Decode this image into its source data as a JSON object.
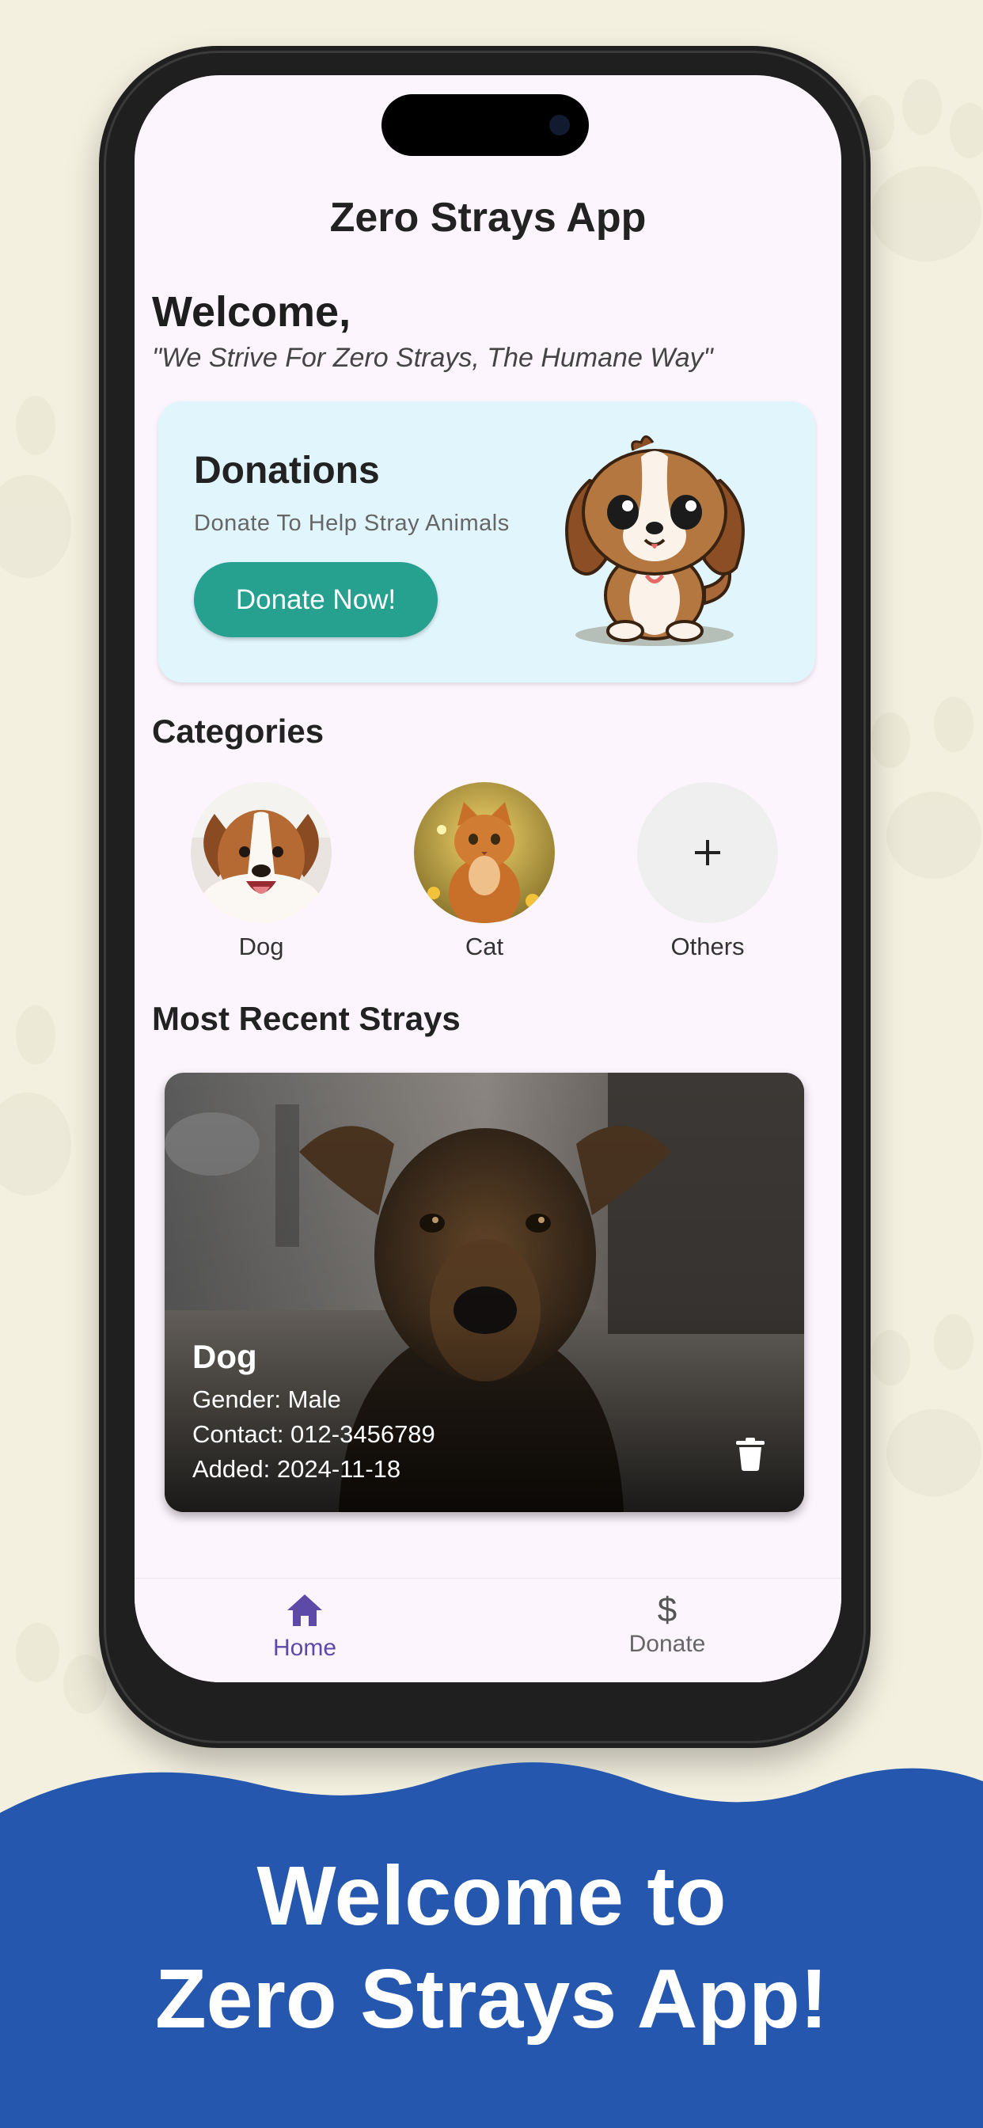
{
  "app": {
    "title": "Zero Strays App",
    "welcome": "Welcome,",
    "quote": "\"We Strive For Zero Strays, The Humane Way\""
  },
  "donation": {
    "title": "Donations",
    "subtitle": "Donate To Help Stray Animals",
    "button_label": "Donate Now!"
  },
  "categories": {
    "title": "Categories",
    "items": [
      {
        "label": "Dog"
      },
      {
        "label": "Cat"
      },
      {
        "label": "Others",
        "icon": "plus-icon"
      }
    ]
  },
  "recent": {
    "title": "Most Recent Strays",
    "card": {
      "name": "Dog",
      "gender": "Gender: Male",
      "contact": "Contact: 012-3456789",
      "added": "Added: 2024-11-18",
      "action_icon": "trash-icon"
    }
  },
  "nav": {
    "items": [
      {
        "label": "Home",
        "icon": "home-icon",
        "active": true
      },
      {
        "label": "Donate",
        "icon": "dollar-icon",
        "active": false
      }
    ]
  },
  "banner": {
    "line1": "Welcome to",
    "line2": "Zero Strays App!"
  },
  "colors": {
    "accent": "#26a08f",
    "nav_active": "#5d4aa8",
    "banner": "#2457ad",
    "card_bg": "#e1f5fd"
  }
}
